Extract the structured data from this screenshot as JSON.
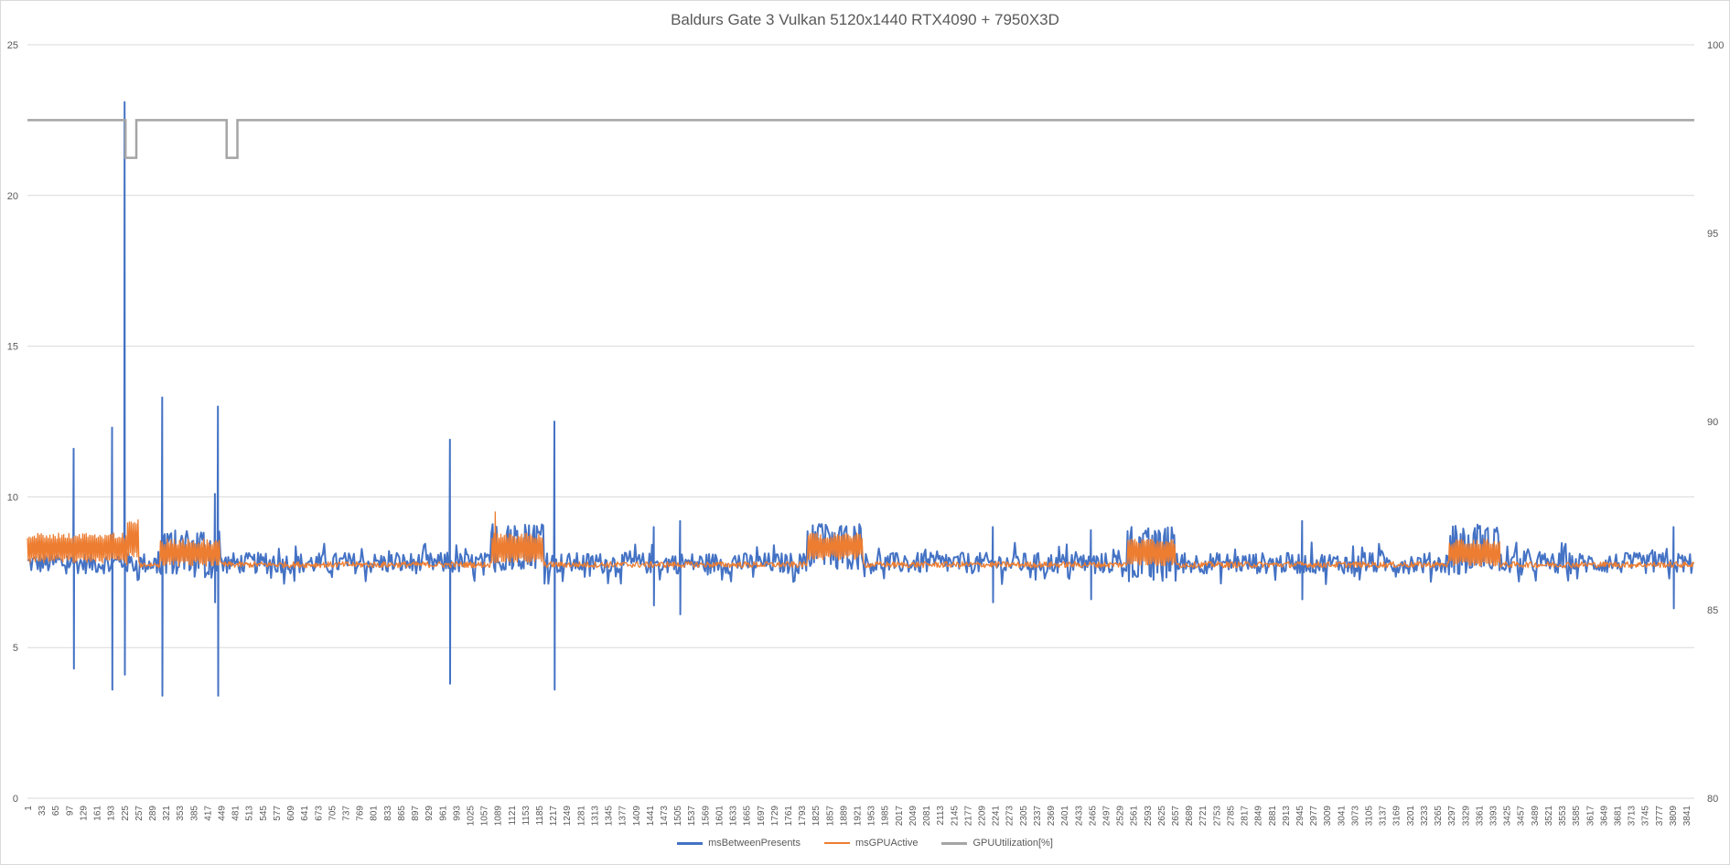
{
  "chart_data": {
    "type": "line",
    "title": "Baldurs Gate 3 Vulkan 5120x1440 RTX4090 + 7950X3D",
    "y_left": {
      "ylim": [
        0,
        25
      ],
      "ticks": [
        "0",
        "5",
        "10",
        "15",
        "20",
        "25"
      ]
    },
    "y_right": {
      "ylim": [
        80,
        100
      ],
      "ticks": [
        "80",
        "85",
        "90",
        "95",
        "100"
      ]
    },
    "x": {
      "range": [
        1,
        3860
      ],
      "ticks": [
        "1",
        "33",
        "65",
        "97",
        "129",
        "161",
        "193",
        "225",
        "257",
        "289",
        "321",
        "353",
        "385",
        "417",
        "449",
        "481",
        "513",
        "545",
        "577",
        "609",
        "641",
        "673",
        "705",
        "737",
        "769",
        "801",
        "833",
        "865",
        "897",
        "929",
        "961",
        "993",
        "1025",
        "1057",
        "1089",
        "1121",
        "1153",
        "1185",
        "1217",
        "1249",
        "1281",
        "1313",
        "1345",
        "1377",
        "1409",
        "1441",
        "1473",
        "1505",
        "1537",
        "1569",
        "1601",
        "1633",
        "1665",
        "1697",
        "1729",
        "1761",
        "1793",
        "1825",
        "1857",
        "1889",
        "1921",
        "1953",
        "1985",
        "2017",
        "2049",
        "2081",
        "2113",
        "2145",
        "2177",
        "2209",
        "2241",
        "2273",
        "2305",
        "2337",
        "2369",
        "2401",
        "2433",
        "2465",
        "2497",
        "2529",
        "2561",
        "2593",
        "2625",
        "2657",
        "2689",
        "2721",
        "2753",
        "2785",
        "2817",
        "2849",
        "2881",
        "2913",
        "2945",
        "2977",
        "3009",
        "3041",
        "3073",
        "3105",
        "3137",
        "3169",
        "3201",
        "3233",
        "3265",
        "3297",
        "3329",
        "3361",
        "3393",
        "3425",
        "3457",
        "3489",
        "3521",
        "3553",
        "3585",
        "3617",
        "3649",
        "3681",
        "3713",
        "3745",
        "3777",
        "3809",
        "3841"
      ]
    },
    "grid": true,
    "legend_position": "bottom",
    "series": [
      {
        "name": "msBetweenPresents",
        "axis": "left",
        "color": "#4472c4",
        "baseline": 7.8,
        "noise_amplitude": 0.35,
        "spikes": [
          {
            "x": 108,
            "high": 11.6,
            "low": 4.3
          },
          {
            "x": 197,
            "high": 12.3,
            "low": 3.6
          },
          {
            "x": 226,
            "high": 23.1,
            "low": 4.1
          },
          {
            "x": 313,
            "high": 13.3,
            "low": 3.4
          },
          {
            "x": 435,
            "high": 10.1,
            "low": 6.5
          },
          {
            "x": 442,
            "high": 13.0,
            "low": 3.4
          },
          {
            "x": 979,
            "high": 11.9,
            "low": 3.8
          },
          {
            "x": 1221,
            "high": 12.5,
            "low": 3.6
          },
          {
            "x": 1451,
            "high": 9.0,
            "low": 6.4
          },
          {
            "x": 1512,
            "high": 9.2,
            "low": 6.1
          },
          {
            "x": 2236,
            "high": 9.0,
            "low": 6.5
          },
          {
            "x": 2463,
            "high": 8.9,
            "low": 6.6
          },
          {
            "x": 2952,
            "high": 9.2,
            "low": 6.6
          },
          {
            "x": 3812,
            "high": 9.0,
            "low": 6.3
          }
        ],
        "high_regions": [
          {
            "x_start": 308,
            "x_end": 447,
            "low": 7.3,
            "high": 8.9
          },
          {
            "x_start": 1075,
            "x_end": 1195,
            "low": 7.5,
            "high": 9.1
          },
          {
            "x_start": 1807,
            "x_end": 1936,
            "low": 7.6,
            "high": 9.1
          },
          {
            "x_start": 2546,
            "x_end": 2660,
            "low": 7.2,
            "high": 9.0
          },
          {
            "x_start": 3290,
            "x_end": 3409,
            "low": 7.4,
            "high": 9.1
          }
        ]
      },
      {
        "name": "msGPUActive",
        "axis": "left",
        "color": "#ed7d31",
        "baseline": 7.75,
        "noise_amplitude": 0.1,
        "bands": [
          {
            "x_start": 1,
            "x_end": 230,
            "low": 7.8,
            "high": 8.8
          },
          {
            "x_start": 233,
            "x_end": 258,
            "low": 8.0,
            "high": 9.3
          },
          {
            "x_start": 308,
            "x_end": 447,
            "low": 7.7,
            "high": 8.6
          },
          {
            "x_start": 1075,
            "x_end": 1195,
            "low": 7.8,
            "high": 8.8
          },
          {
            "x_start": 1807,
            "x_end": 1936,
            "low": 7.9,
            "high": 8.8
          },
          {
            "x_start": 2546,
            "x_end": 2660,
            "low": 7.7,
            "high": 8.6
          },
          {
            "x_start": 3290,
            "x_end": 3409,
            "low": 7.7,
            "high": 8.6
          }
        ],
        "peaks": [
          {
            "x": 1084,
            "value": 9.5
          }
        ]
      },
      {
        "name": "GPUUtilization[%]",
        "axis": "right",
        "color": "#a5a5a5",
        "baseline": 98,
        "dips": [
          {
            "x_start": 228,
            "x_end": 253,
            "value": 97
          },
          {
            "x_start": 462,
            "x_end": 487,
            "value": 97
          }
        ]
      }
    ]
  }
}
